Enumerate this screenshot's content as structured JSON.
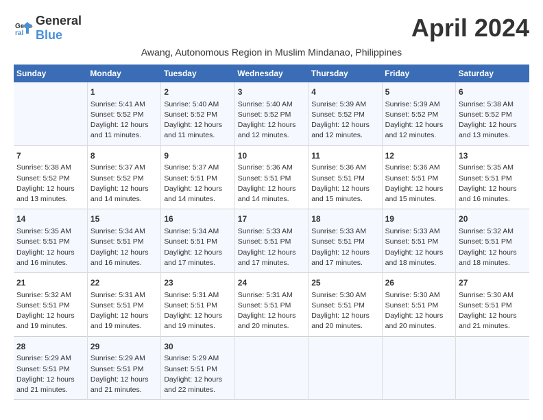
{
  "header": {
    "logo_general": "General",
    "logo_blue": "Blue",
    "month_title": "April 2024",
    "subtitle": "Awang, Autonomous Region in Muslim Mindanao, Philippines"
  },
  "calendar": {
    "days_of_week": [
      "Sunday",
      "Monday",
      "Tuesday",
      "Wednesday",
      "Thursday",
      "Friday",
      "Saturday"
    ],
    "weeks": [
      [
        {
          "day": "",
          "content": ""
        },
        {
          "day": "1",
          "content": "Sunrise: 5:41 AM\nSunset: 5:52 PM\nDaylight: 12 hours\nand 11 minutes."
        },
        {
          "day": "2",
          "content": "Sunrise: 5:40 AM\nSunset: 5:52 PM\nDaylight: 12 hours\nand 11 minutes."
        },
        {
          "day": "3",
          "content": "Sunrise: 5:40 AM\nSunset: 5:52 PM\nDaylight: 12 hours\nand 12 minutes."
        },
        {
          "day": "4",
          "content": "Sunrise: 5:39 AM\nSunset: 5:52 PM\nDaylight: 12 hours\nand 12 minutes."
        },
        {
          "day": "5",
          "content": "Sunrise: 5:39 AM\nSunset: 5:52 PM\nDaylight: 12 hours\nand 12 minutes."
        },
        {
          "day": "6",
          "content": "Sunrise: 5:38 AM\nSunset: 5:52 PM\nDaylight: 12 hours\nand 13 minutes."
        }
      ],
      [
        {
          "day": "7",
          "content": "Sunrise: 5:38 AM\nSunset: 5:52 PM\nDaylight: 12 hours\nand 13 minutes."
        },
        {
          "day": "8",
          "content": "Sunrise: 5:37 AM\nSunset: 5:52 PM\nDaylight: 12 hours\nand 14 minutes."
        },
        {
          "day": "9",
          "content": "Sunrise: 5:37 AM\nSunset: 5:51 PM\nDaylight: 12 hours\nand 14 minutes."
        },
        {
          "day": "10",
          "content": "Sunrise: 5:36 AM\nSunset: 5:51 PM\nDaylight: 12 hours\nand 14 minutes."
        },
        {
          "day": "11",
          "content": "Sunrise: 5:36 AM\nSunset: 5:51 PM\nDaylight: 12 hours\nand 15 minutes."
        },
        {
          "day": "12",
          "content": "Sunrise: 5:36 AM\nSunset: 5:51 PM\nDaylight: 12 hours\nand 15 minutes."
        },
        {
          "day": "13",
          "content": "Sunrise: 5:35 AM\nSunset: 5:51 PM\nDaylight: 12 hours\nand 16 minutes."
        }
      ],
      [
        {
          "day": "14",
          "content": "Sunrise: 5:35 AM\nSunset: 5:51 PM\nDaylight: 12 hours\nand 16 minutes."
        },
        {
          "day": "15",
          "content": "Sunrise: 5:34 AM\nSunset: 5:51 PM\nDaylight: 12 hours\nand 16 minutes."
        },
        {
          "day": "16",
          "content": "Sunrise: 5:34 AM\nSunset: 5:51 PM\nDaylight: 12 hours\nand 17 minutes."
        },
        {
          "day": "17",
          "content": "Sunrise: 5:33 AM\nSunset: 5:51 PM\nDaylight: 12 hours\nand 17 minutes."
        },
        {
          "day": "18",
          "content": "Sunrise: 5:33 AM\nSunset: 5:51 PM\nDaylight: 12 hours\nand 17 minutes."
        },
        {
          "day": "19",
          "content": "Sunrise: 5:33 AM\nSunset: 5:51 PM\nDaylight: 12 hours\nand 18 minutes."
        },
        {
          "day": "20",
          "content": "Sunrise: 5:32 AM\nSunset: 5:51 PM\nDaylight: 12 hours\nand 18 minutes."
        }
      ],
      [
        {
          "day": "21",
          "content": "Sunrise: 5:32 AM\nSunset: 5:51 PM\nDaylight: 12 hours\nand 19 minutes."
        },
        {
          "day": "22",
          "content": "Sunrise: 5:31 AM\nSunset: 5:51 PM\nDaylight: 12 hours\nand 19 minutes."
        },
        {
          "day": "23",
          "content": "Sunrise: 5:31 AM\nSunset: 5:51 PM\nDaylight: 12 hours\nand 19 minutes."
        },
        {
          "day": "24",
          "content": "Sunrise: 5:31 AM\nSunset: 5:51 PM\nDaylight: 12 hours\nand 20 minutes."
        },
        {
          "day": "25",
          "content": "Sunrise: 5:30 AM\nSunset: 5:51 PM\nDaylight: 12 hours\nand 20 minutes."
        },
        {
          "day": "26",
          "content": "Sunrise: 5:30 AM\nSunset: 5:51 PM\nDaylight: 12 hours\nand 20 minutes."
        },
        {
          "day": "27",
          "content": "Sunrise: 5:30 AM\nSunset: 5:51 PM\nDaylight: 12 hours\nand 21 minutes."
        }
      ],
      [
        {
          "day": "28",
          "content": "Sunrise: 5:29 AM\nSunset: 5:51 PM\nDaylight: 12 hours\nand 21 minutes."
        },
        {
          "day": "29",
          "content": "Sunrise: 5:29 AM\nSunset: 5:51 PM\nDaylight: 12 hours\nand 21 minutes."
        },
        {
          "day": "30",
          "content": "Sunrise: 5:29 AM\nSunset: 5:51 PM\nDaylight: 12 hours\nand 22 minutes."
        },
        {
          "day": "",
          "content": ""
        },
        {
          "day": "",
          "content": ""
        },
        {
          "day": "",
          "content": ""
        },
        {
          "day": "",
          "content": ""
        }
      ]
    ]
  }
}
